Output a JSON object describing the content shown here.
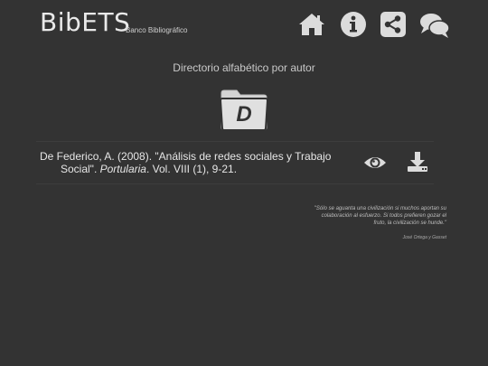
{
  "header": {
    "logo_text": "BibETS",
    "logo_subtitle": "Banco Bibliográfico",
    "nav": [
      {
        "name": "home-icon"
      },
      {
        "name": "info-icon"
      },
      {
        "name": "share-icon"
      },
      {
        "name": "comments-icon"
      }
    ]
  },
  "main": {
    "subtitle": "Directorio alfabético por autor",
    "letter": "D",
    "entries": [
      {
        "pre": "De Federico, A. (2008). \"Análisis de redes sociales y Trabajo",
        "line2_pre": "Social\". ",
        "journal": "Portularia",
        "post": ". Vol. VIII (1), 9-21.",
        "actions": [
          "eye-icon",
          "download-icon"
        ]
      }
    ]
  },
  "quote": {
    "text": "\"Sólo se aguanta una civilización si muchos aportan su colaboración al esfuerzo. Si todos prefieren gozar el fruto, la civilización se hunde.\"",
    "author": "José Ortega y Gasset"
  },
  "colors": {
    "background": "#333333",
    "icon": "#dcdcdc",
    "text": "#e6e6e6"
  }
}
